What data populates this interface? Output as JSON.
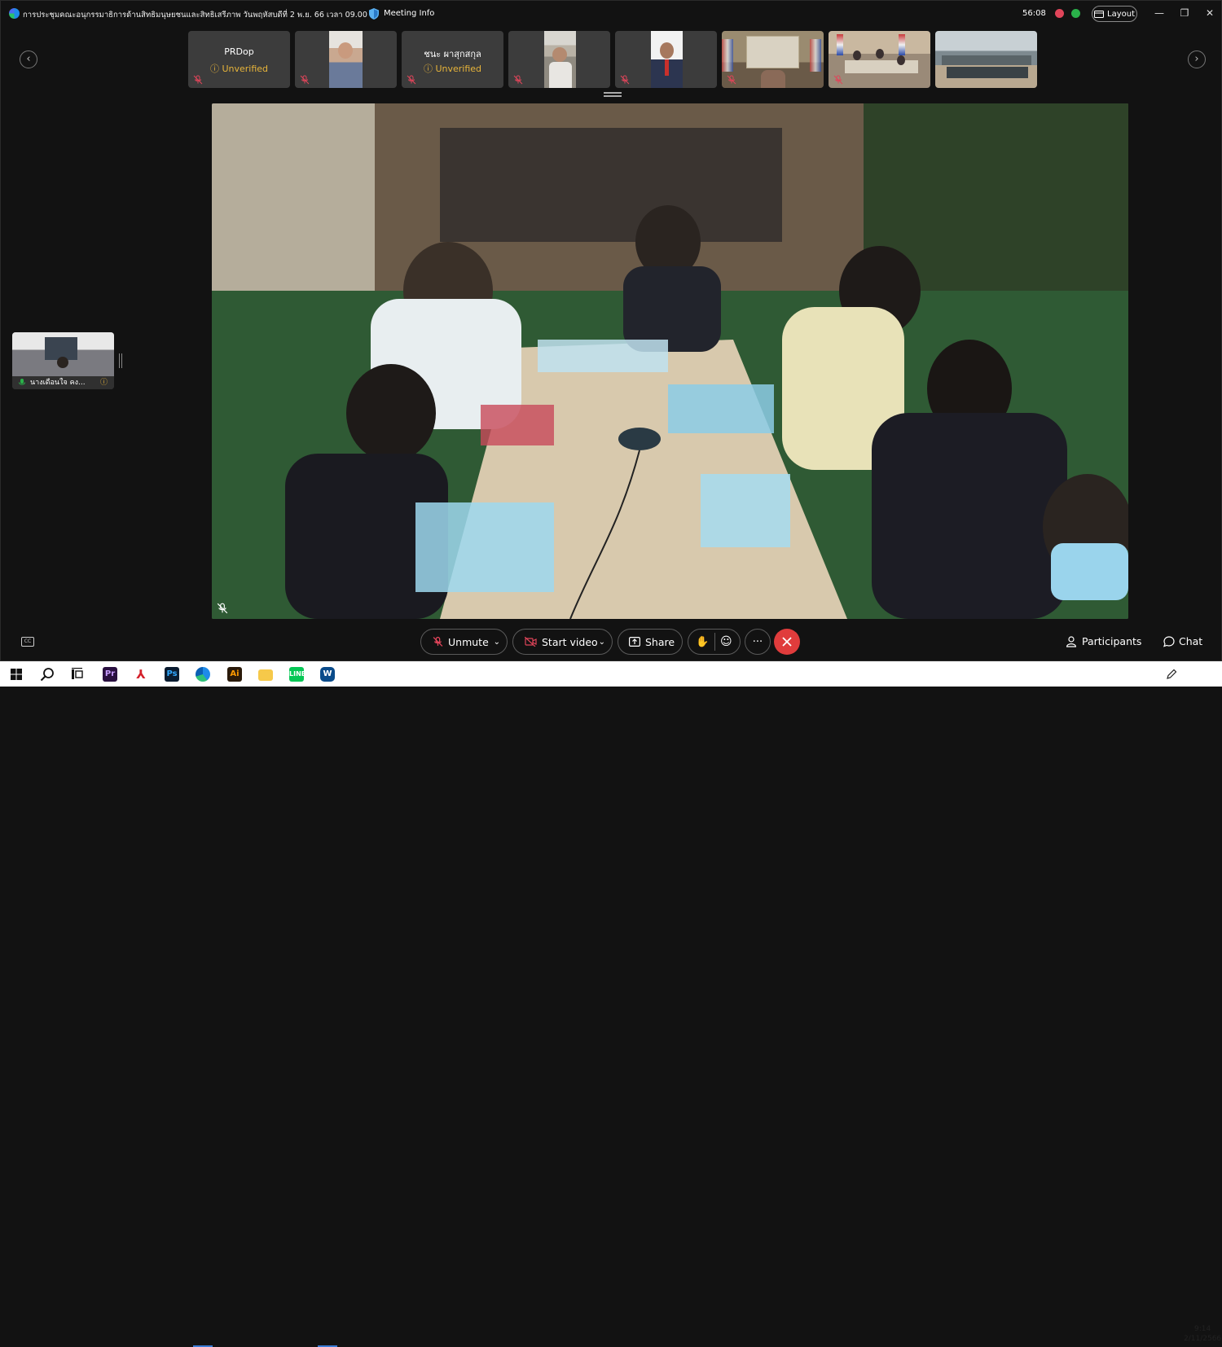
{
  "window": {
    "meeting_title": "การประชุมคณะอนุกรรมาธิการด้านสิทธิมนุษยชนและสิทธิเสรีภาพ วันพฤหัสบดีที่ 2 พ.ย. 66 เวลา 09.00 น.",
    "meeting_info_label": "Meeting Info",
    "elapsed_time": "56:08",
    "layout_label": "Layout",
    "colors": {
      "recording_red": "#e0455a",
      "active_green": "#2ab14a",
      "end_call_red": "#e03c3c",
      "unverified_yellow": "#e8b53a"
    }
  },
  "filmstrip": {
    "participants": [
      {
        "name": "PRDop",
        "status": "Unverified",
        "video": false
      },
      {
        "name": "",
        "status": "",
        "video": true
      },
      {
        "name": "ชนะ ผาสุกสกุล",
        "status": "Unverified",
        "video": false
      },
      {
        "name": "",
        "status": "",
        "video": true
      },
      {
        "name": "",
        "status": "",
        "video": true
      },
      {
        "name": "",
        "status": "",
        "video": true
      },
      {
        "name": "",
        "status": "",
        "video": true
      },
      {
        "name": "",
        "status": "",
        "video": true
      }
    ]
  },
  "self_view": {
    "name": "นางเดือนใจ คง..."
  },
  "controls": {
    "unmute_label": "Unmute",
    "start_video_label": "Start video",
    "share_label": "Share",
    "participants_label": "Participants",
    "chat_label": "Chat"
  },
  "taskbar": {
    "apps": [
      "windows-start",
      "search",
      "task-view",
      "premiere-pro",
      "acrobat",
      "photoshop",
      "edge",
      "illustrator",
      "file-explorer",
      "line",
      "webex"
    ],
    "time": "9:14",
    "date": "2/11/2566"
  }
}
